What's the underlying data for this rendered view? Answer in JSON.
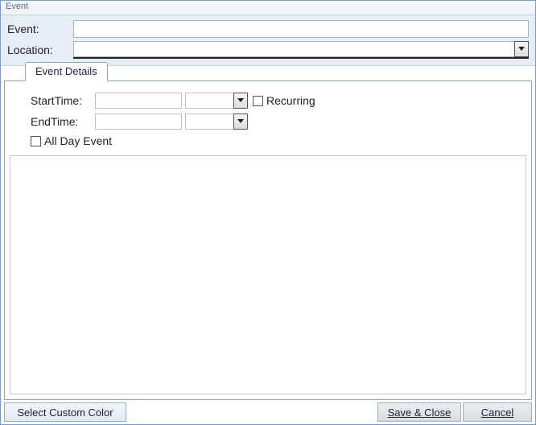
{
  "window": {
    "title": "Event"
  },
  "header": {
    "event_label": "Event:",
    "event_value": "",
    "location_label": "Location:",
    "location_value": ""
  },
  "tabs": {
    "details_label": "Event Details"
  },
  "details": {
    "start_label": "StartTime:",
    "start_date": "",
    "start_time": "",
    "end_label": "EndTime:",
    "end_date": "",
    "end_time": "",
    "recurring_label": "Recurring",
    "recurring_checked": false,
    "allday_label": "All Day Event",
    "allday_checked": false,
    "notes": ""
  },
  "footer": {
    "color_button": "Select Custom Color",
    "save_button": "Save & Close",
    "cancel_button": "Cancel"
  }
}
